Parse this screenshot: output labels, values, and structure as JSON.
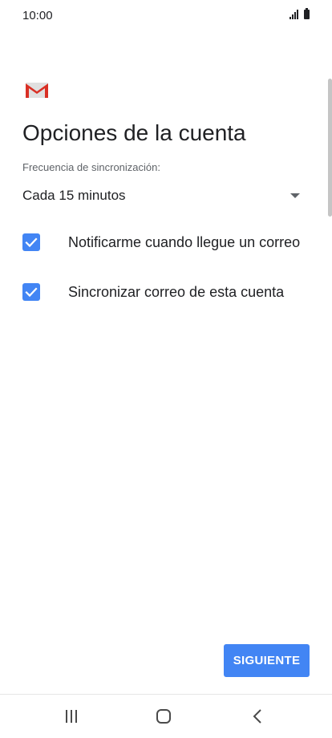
{
  "status_bar": {
    "time": "10:00",
    "signal_icon": "signal-icon",
    "battery_icon": "battery-icon"
  },
  "logo": {
    "icon": "gmail-icon",
    "colors": {
      "red": "#d93025",
      "gray": "#e0e0e0"
    }
  },
  "page": {
    "title": "Opciones de la cuenta"
  },
  "sync_frequency": {
    "label": "Frecuencia de sincronización:",
    "value": "Cada 15 minutos"
  },
  "options": [
    {
      "label": "Notificarme cuando llegue un correo",
      "checked": true
    },
    {
      "label": "Sincronizar correo de esta cuenta",
      "checked": true
    }
  ],
  "actions": {
    "next_label": "SIGUIENTE"
  },
  "colors": {
    "accent": "#4285f4"
  },
  "nav": {
    "recents_icon": "recents-icon",
    "home_icon": "home-icon",
    "back_icon": "back-icon"
  }
}
